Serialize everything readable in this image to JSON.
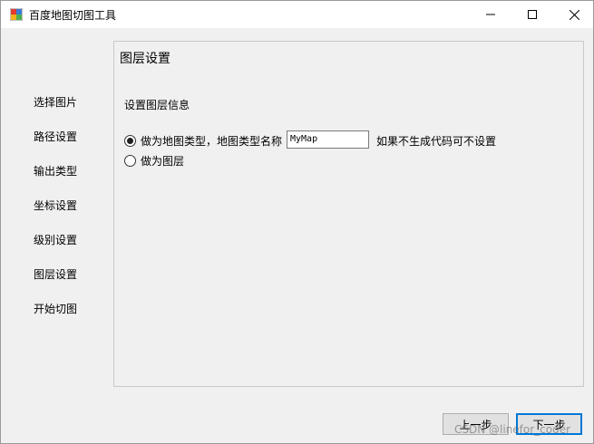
{
  "window": {
    "title": "百度地图切图工具",
    "icon": "app-map-icon"
  },
  "sidebar": {
    "items": [
      {
        "label": "选择图片"
      },
      {
        "label": "路径设置"
      },
      {
        "label": "输出类型"
      },
      {
        "label": "坐标设置"
      },
      {
        "label": "级别设置"
      },
      {
        "label": "图层设置"
      },
      {
        "label": "开始切图"
      }
    ]
  },
  "panel": {
    "title": "图层设置",
    "section_label": "设置图层信息",
    "option_maptype": {
      "label": "做为地图类型，地图类型名称",
      "checked": true
    },
    "option_layer": {
      "label": "做为图层",
      "checked": false
    },
    "map_type_name_value": "MyMap",
    "hint": "如果不生成代码可不设置"
  },
  "buttons": {
    "prev_label": "上一步",
    "next_label": "下一步"
  },
  "watermark": "CSDN @linefor_coder"
}
